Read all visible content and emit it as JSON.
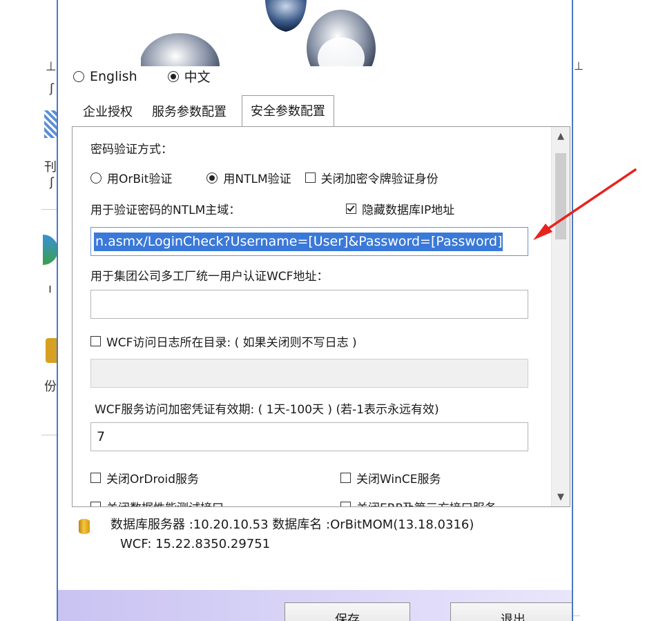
{
  "background": {
    "fragments": [
      "⊥",
      "ʃ",
      "刊",
      "ʃ",
      "份",
      "ı"
    ]
  },
  "language": {
    "english_label": "English",
    "chinese_label": "中文",
    "selected": "中文"
  },
  "tabs": [
    {
      "label": "企业授权",
      "active": false
    },
    {
      "label": "服务参数配置",
      "active": false
    },
    {
      "label": "安全参数配置",
      "active": true
    }
  ],
  "security": {
    "verify_method_label": "密码验证方式：",
    "orbit_verify_label": "用OrBit验证",
    "ntlm_verify_label": "用NTLM验证",
    "ntlm_selected": true,
    "disable_token_label": "关闭加密令牌验证身份",
    "disable_token_checked": false,
    "ntlm_domain_label": "用于验证密码的NTLM主域：",
    "hide_db_ip_label": "隐藏数据库IP地址",
    "hide_db_ip_checked": true,
    "ntlm_domain_value": "n.asmx/LoginCheck?Username=[User]&Password=[Password]",
    "wcf_address_label": "用于集团公司多工厂统一用户认证WCF地址：",
    "wcf_address_value": "",
    "wcf_log_label": "WCF访问日志所在目录: ( 如果关闭则不写日志 )",
    "wcf_log_checked": false,
    "wcf_log_value": "",
    "wcf_expiry_label": "WCF服务访问加密凭证有效期: ( 1天-100天 ) (若-1表示永远有效)",
    "wcf_expiry_value": "7",
    "disable_ordroid_label": "关闭OrDroid服务",
    "disable_wince_label": "关闭WinCE服务",
    "disable_perf_label": "关闭数据性能测试接口",
    "disable_erp_label": "关闭ERP及第三方接口服务"
  },
  "status": {
    "line1": "数据库服务器  :10.20.10.53  数据库名 :OrBitMOM(13.18.0316)",
    "line2": "WCF: 15.22.8350.29751"
  },
  "buttons": {
    "save_label": "保存",
    "exit_label": "退出"
  },
  "colors": {
    "selection": "#3a79d8",
    "annotation_arrow": "#e8231f",
    "window_border": "#4a78c2"
  }
}
